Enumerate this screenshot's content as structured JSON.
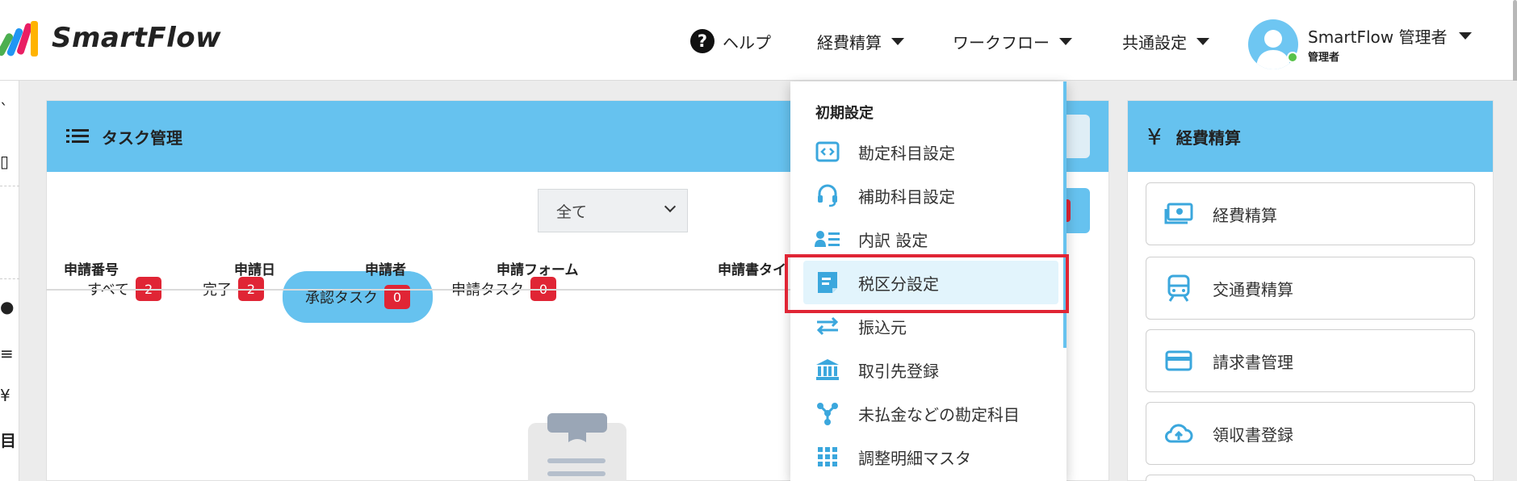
{
  "header": {
    "app_name": "SmartFlow",
    "nav": {
      "help": "ヘルプ",
      "expense": "経費精算",
      "workflow": "ワークフロー",
      "common_settings": "共通設定"
    },
    "user": {
      "name": "SmartFlow 管理者",
      "role": "管理者"
    }
  },
  "task_panel": {
    "title": "タスク管理",
    "filters": [
      {
        "label": "すべて",
        "count": "2"
      },
      {
        "label": "完了",
        "count": "2"
      },
      {
        "label": "承認タスク",
        "count": "0"
      },
      {
        "label": "申請タスク",
        "count": "0"
      }
    ],
    "select_value": "全て",
    "columns": [
      "申請番号",
      "申請日",
      "申請者",
      "申請フォーム",
      "申請書タイ"
    ]
  },
  "dropdown": {
    "heading": "初期設定",
    "items": [
      {
        "label": "勘定科目設定",
        "icon": "code-card-icon"
      },
      {
        "label": "補助科目設定",
        "icon": "headset-icon"
      },
      {
        "label": "内訳 設定",
        "icon": "contact-list-icon"
      },
      {
        "label": "税区分設定",
        "icon": "document-icon"
      },
      {
        "label": "振込元",
        "icon": "transfer-arrows-icon"
      },
      {
        "label": "取引先登録",
        "icon": "bank-icon"
      },
      {
        "label": "未払金などの勘定科目",
        "icon": "network-icon"
      },
      {
        "label": "調整明細マスタ",
        "icon": "grid-icon"
      }
    ],
    "selected_index": 3
  },
  "expense_panel": {
    "title": "経費精算",
    "buttons": [
      {
        "label": "経費精算",
        "icon": "cash-icon"
      },
      {
        "label": "交通費精算",
        "icon": "train-icon"
      },
      {
        "label": "請求書管理",
        "icon": "credit-card-icon"
      },
      {
        "label": "領収書登録",
        "icon": "cloud-upload-icon"
      }
    ]
  },
  "colors": {
    "accent": "#66c2ef",
    "badge": "#e02535",
    "highlight": "#e02535",
    "icon_blue": "#3ba7dd"
  }
}
